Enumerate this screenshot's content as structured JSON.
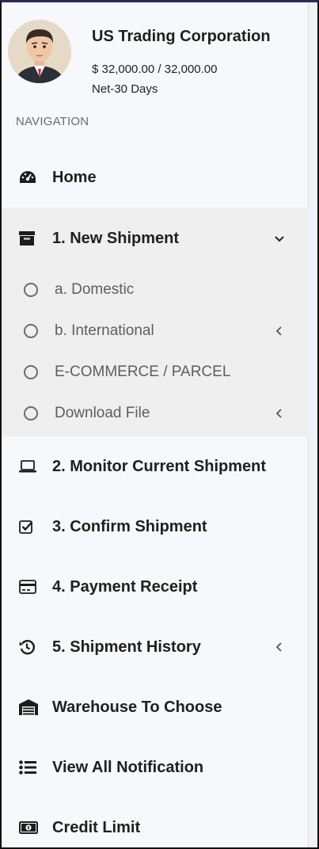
{
  "profile": {
    "company": "US Trading Corporation",
    "credit": "$ 32,000.00 / 32,000.00",
    "terms": "Net-30 Days",
    "avatar_icon": "user-avatar"
  },
  "navigation": {
    "header": "NAVIGATION",
    "items": [
      {
        "label": "Home",
        "icon": "dashboard-icon"
      },
      {
        "label": "1. New Shipment",
        "icon": "archive-box-icon",
        "expanded": true,
        "children": [
          {
            "label": "a. Domestic",
            "has_submenu": false
          },
          {
            "label": "b. International",
            "has_submenu": true
          },
          {
            "label": "E-COMMERCE / PARCEL",
            "has_submenu": false
          },
          {
            "label": "Download File",
            "has_submenu": true
          }
        ]
      },
      {
        "label": "2. Monitor Current Shipment",
        "icon": "laptop-icon"
      },
      {
        "label": "3. Confirm Shipment",
        "icon": "checkbox-icon"
      },
      {
        "label": "4. Payment Receipt",
        "icon": "credit-card-icon"
      },
      {
        "label": "5. Shipment History",
        "icon": "history-icon",
        "has_submenu": true
      },
      {
        "label": "Warehouse To Choose",
        "icon": "warehouse-icon"
      },
      {
        "label": "View All Notification",
        "icon": "list-icon"
      },
      {
        "label": "Credit Limit",
        "icon": "money-bill-icon"
      }
    ]
  },
  "colors": {
    "sidebar_bg": "#f7f8fb",
    "active_group_bg": "#efefef",
    "text_primary": "#202020",
    "text_secondary": "#5e5e5e"
  }
}
